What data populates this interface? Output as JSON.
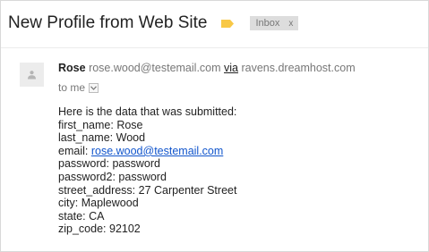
{
  "message": {
    "subject": "New Profile from Web Site",
    "label_color": "#f8c846",
    "inbox_chip": {
      "label": "Inbox",
      "close": "x"
    },
    "sender": {
      "name": "Rose",
      "email": "rose.wood@testemail.com",
      "via_label": "via",
      "via_domain": "ravens.dreamhost.com"
    },
    "recipient": {
      "text": "to me"
    },
    "body": {
      "intro": "Here is the data that was submitted:",
      "fields": [
        {
          "key": "first_name:",
          "value": "Rose"
        },
        {
          "key": "last_name:",
          "value": "Wood"
        },
        {
          "key": "email:",
          "value": "rose.wood@testemail.com"
        },
        {
          "key": "password:",
          "value": "password"
        },
        {
          "key": "password2:",
          "value": "password"
        },
        {
          "key": "street_address:",
          "value": "27 Carpenter Street"
        },
        {
          "key": "city:",
          "value": "Maplewood"
        },
        {
          "key": "state:",
          "value": "CA"
        },
        {
          "key": "zip_code:",
          "value": "92102"
        }
      ]
    }
  },
  "icons": {
    "label": "label-tag-icon",
    "avatar": "person-icon",
    "toggle": "chevron-down-icon"
  }
}
